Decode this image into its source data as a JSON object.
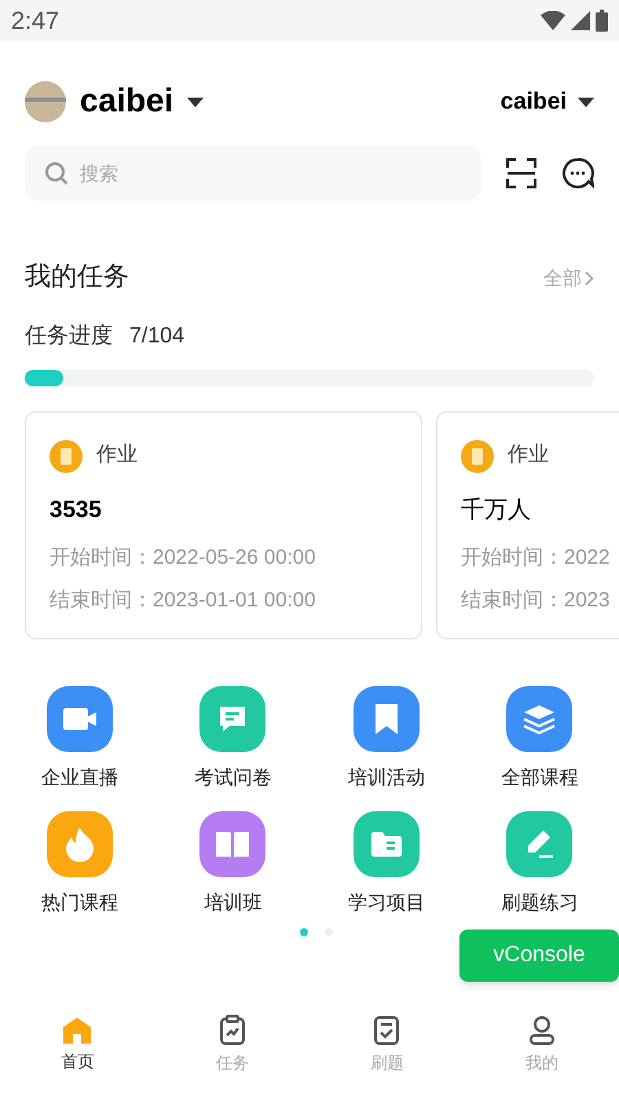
{
  "status_bar": {
    "time": "2:47"
  },
  "header": {
    "user": "caibei",
    "org": "caibei"
  },
  "search": {
    "placeholder": "搜索"
  },
  "tasks": {
    "title": "我的任务",
    "more": "全部",
    "progress_label": "任务进度",
    "progress_value": "7/104",
    "level": 0.067,
    "cards": [
      {
        "type": "作业",
        "name": "3535",
        "bold": true,
        "start": "开始时间：2022-05-26 00:00",
        "end": "结束时间：2023-01-01 00:00"
      },
      {
        "type": "作业",
        "name": "千万人",
        "bold": false,
        "start": "开始时间：2022",
        "end": "结束时间：2023"
      }
    ]
  },
  "shortcuts": [
    {
      "label": "企业直播",
      "kind": "video",
      "color": "#3b8ff5"
    },
    {
      "label": "考试问卷",
      "kind": "chat",
      "color": "#22c9a0"
    },
    {
      "label": "培训活动",
      "kind": "bookmark",
      "color": "#3b8ff5"
    },
    {
      "label": "全部课程",
      "kind": "layers",
      "color": "#3b8ff5"
    },
    {
      "label": "热门课程",
      "kind": "fire",
      "color": "#fba70f"
    },
    {
      "label": "培训班",
      "kind": "book",
      "color": "#b57cf3"
    },
    {
      "label": "学习项目",
      "kind": "folder",
      "color": "#22c9a0"
    },
    {
      "label": "刷题练习",
      "kind": "pen",
      "color": "#22c9a0"
    }
  ],
  "pager": [
    {
      "selected": true
    },
    {
      "selected": false
    }
  ],
  "vconsole": "vConsole",
  "tabs": [
    {
      "label": "首页",
      "kind": "home",
      "selected": true
    },
    {
      "label": "任务",
      "kind": "clipboard",
      "selected": false
    },
    {
      "label": "刷题",
      "kind": "check",
      "selected": false
    },
    {
      "label": "我的",
      "kind": "person",
      "selected": false
    }
  ]
}
